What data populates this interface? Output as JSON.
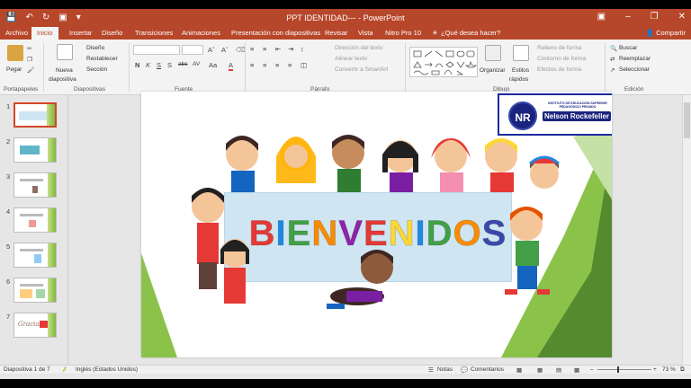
{
  "titlebar": {
    "title": "PPT IDENTIDAD--- - PowerPoint",
    "qat": [
      "save-icon",
      "undo-icon",
      "redo-icon",
      "present-icon",
      "customize-icon"
    ]
  },
  "tabs": {
    "file": "Archivo",
    "items": [
      "Inicio",
      "Insertar",
      "Diseño",
      "Transiciones",
      "Animaciones",
      "Presentación con diapositivas",
      "Revisar",
      "Vista",
      "Nitro Pro 10"
    ],
    "tell_me": "¿Qué desea hacer?",
    "share": "Compartir",
    "active": "Inicio"
  },
  "ribbon": {
    "groups": [
      "Portapapeles",
      "Diapositivas",
      "Fuente",
      "Párrafo",
      "Dibujo",
      "Edición"
    ],
    "paste": "Pegar",
    "new_slide": "Nueva",
    "new_slide2": "diapositiva",
    "design": "Diseño",
    "reset": "Restablecer",
    "section": "Sección",
    "text_dir": "Dirección del texto",
    "align_text": "Alinear texto",
    "smartart": "Convertir a SmartArt",
    "arrange": "Organizar",
    "quick_styles": "Estilos",
    "quick_styles2": "rápidos",
    "fill": "Relleno de forma",
    "outline": "Contorno de forma",
    "effects": "Efectos de forma",
    "find": "Buscar",
    "replace": "Reemplazar",
    "select": "Seleccionar",
    "font_buttons": [
      "N",
      "K",
      "S",
      "S",
      "abc",
      "AV",
      "Aa",
      "A"
    ]
  },
  "thumbnails": [
    {
      "num": "1",
      "label": ""
    },
    {
      "num": "2",
      "label": ""
    },
    {
      "num": "3",
      "label": ""
    },
    {
      "num": "4",
      "label": ""
    },
    {
      "num": "5",
      "label": ""
    },
    {
      "num": "6",
      "label": ""
    },
    {
      "num": "7",
      "label": "Gracias"
    }
  ],
  "slide": {
    "heading_letters": [
      "B",
      "I",
      "E",
      "N",
      "V",
      "E",
      "N",
      "I",
      "D",
      "O",
      "S"
    ],
    "heading_colors": [
      "#e53935",
      "#1e88e5",
      "#43a047",
      "#fb8c00",
      "#8e24aa",
      "#e53935",
      "#fdd835",
      "#1e88e5",
      "#43a047",
      "#fb8c00",
      "#3949ab"
    ],
    "logo_initials": "NR",
    "logo_name": "Nelson Rockefeller",
    "logo_institution": "INSTITUTO DE EDUCACIÓN SUPERIOR PEDAGÓGICO PRIVADO"
  },
  "status": {
    "slide_info": "Diapositiva 1 de 7",
    "language": "Inglés (Estados Unidos)",
    "notes": "Notas",
    "comments": "Comentarios",
    "zoom": "73 %",
    "zoom_level": 0.73
  },
  "colors": {
    "accent": "#b7472a",
    "selected": "#d24726"
  }
}
